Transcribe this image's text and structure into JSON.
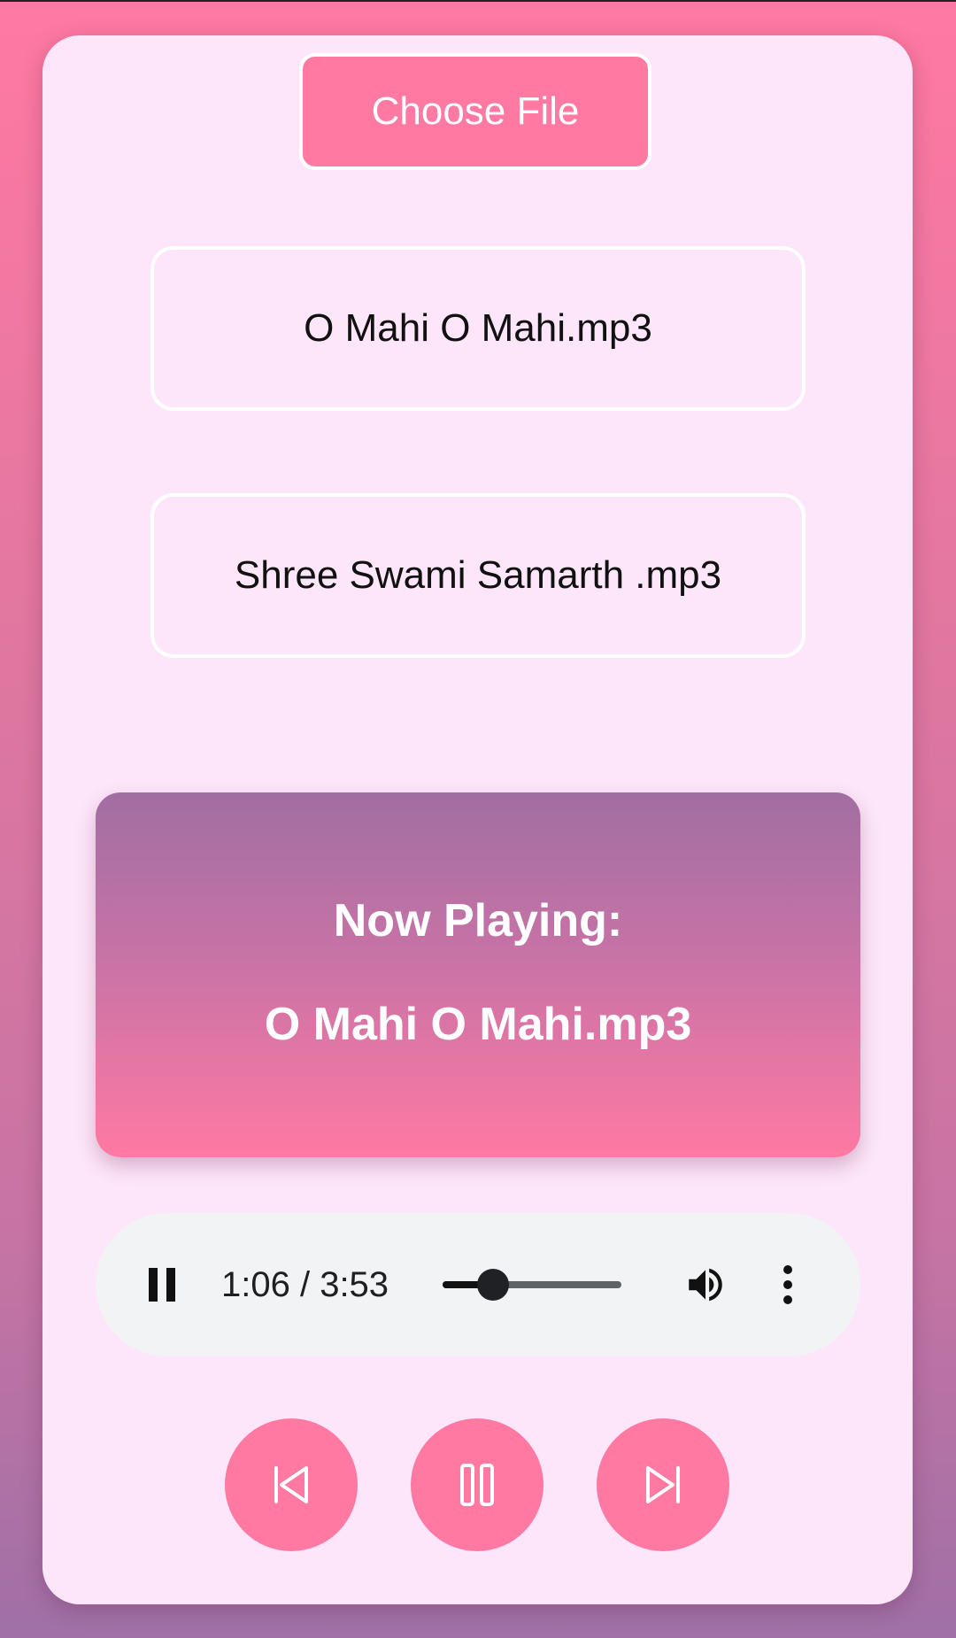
{
  "colors": {
    "accent": "#ff79a2",
    "card_bg": "#fde6f9",
    "player_bg": "#f1f3f4",
    "now_playing_top": "#a16ea2",
    "now_playing_bottom": "#ff79a3"
  },
  "file_picker": {
    "label": "Choose File"
  },
  "playlist": {
    "items": [
      {
        "label": "O Mahi O Mahi.mp3"
      },
      {
        "label": "Shree Swami Samarth .mp3"
      }
    ]
  },
  "now_playing": {
    "label": "Now Playing:",
    "title": "O Mahi O Mahi.mp3"
  },
  "audio_player": {
    "state_icon": "pause-icon",
    "time": "1:06 / 3:53",
    "current_seconds": 66,
    "duration_seconds": 233,
    "volume_icon": "volume-icon",
    "menu_icon": "more-vert-icon"
  },
  "controls": {
    "previous_icon": "skip-previous-icon",
    "play_pause_icon": "pause-icon",
    "next_icon": "skip-next-icon"
  }
}
